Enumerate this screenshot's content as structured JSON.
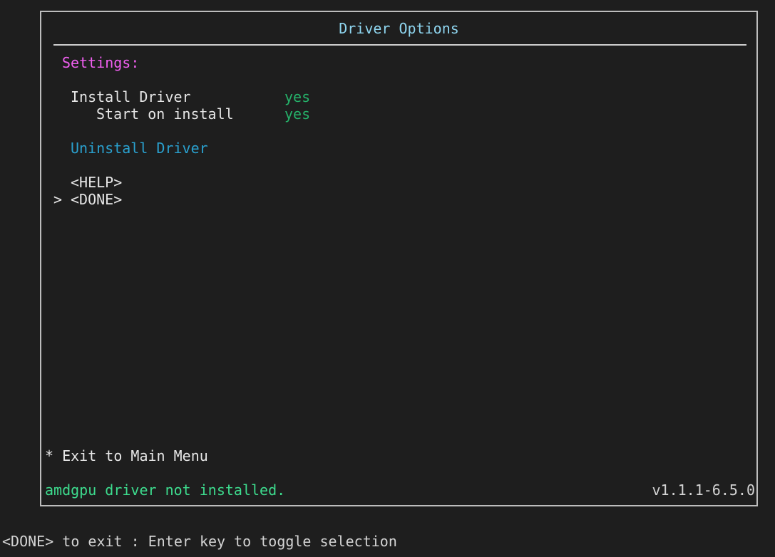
{
  "window": {
    "title": "Driver Options"
  },
  "settings": {
    "heading": "Settings:",
    "install_driver": {
      "label": "Install Driver",
      "value": "yes"
    },
    "start_on_install": {
      "label": "Start on install",
      "value": "yes"
    }
  },
  "actions": {
    "uninstall": "Uninstall Driver",
    "help": "<HELP>",
    "done": "<DONE>",
    "cursor": ">"
  },
  "menu": {
    "exit_hint": "* Exit to Main Menu"
  },
  "status": {
    "message": "amdgpu driver not installed.",
    "version": "v1.1.1-6.5.0"
  },
  "footer": {
    "hint": "<DONE> to exit : Enter key to toggle selection"
  },
  "colors": {
    "background": "#1e1e1e",
    "title": "#8fd6f0",
    "heading": "#f05ff0",
    "value_yes": "#25b26a",
    "link": "#2aa1cf",
    "status": "#3ddc8e"
  }
}
